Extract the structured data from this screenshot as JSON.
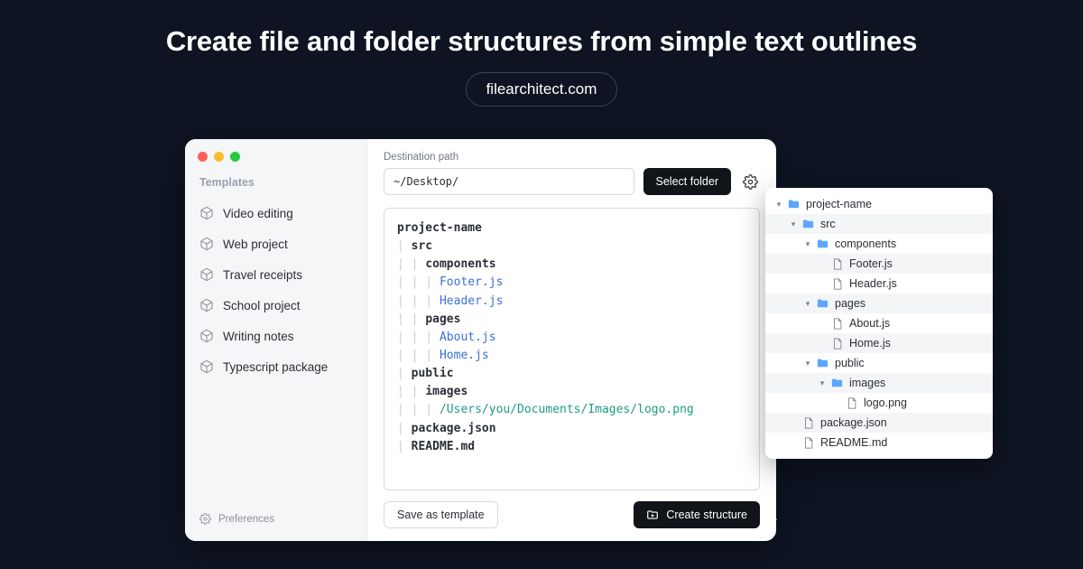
{
  "hero": {
    "title": "Create file and folder structures from simple text outlines",
    "url_badge": "filearchitect.com"
  },
  "sidebar": {
    "heading": "Templates",
    "items": [
      {
        "label": "Video editing"
      },
      {
        "label": "Web project"
      },
      {
        "label": "Travel receipts"
      },
      {
        "label": "School project"
      },
      {
        "label": "Writing notes"
      },
      {
        "label": "Typescript package"
      }
    ],
    "prefs": "Preferences"
  },
  "main": {
    "dest_label": "Destination path",
    "dest_value": "~/Desktop/",
    "select_folder": "Select folder",
    "save_template": "Save as template",
    "create_structure": "Create structure"
  },
  "outline": {
    "l0": "project-name",
    "l1": "src",
    "l2": "components",
    "l3": "Footer.js",
    "l4": "Header.js",
    "l5": "pages",
    "l6": "About.js",
    "l7": "Home.js",
    "l8": "public",
    "l9": "images",
    "l10": "/Users/you/Documents/Images/logo.png",
    "l11": "package.json",
    "l12": "README.md"
  },
  "finder": {
    "items": [
      {
        "name": "project-name",
        "type": "folder",
        "depth": 0,
        "open": true
      },
      {
        "name": "src",
        "type": "folder",
        "depth": 1,
        "open": true
      },
      {
        "name": "components",
        "type": "folder",
        "depth": 2,
        "open": true
      },
      {
        "name": "Footer.js",
        "type": "file",
        "depth": 3
      },
      {
        "name": "Header.js",
        "type": "file",
        "depth": 3
      },
      {
        "name": "pages",
        "type": "folder",
        "depth": 2,
        "open": true
      },
      {
        "name": "About.js",
        "type": "file",
        "depth": 3
      },
      {
        "name": "Home.js",
        "type": "file",
        "depth": 3
      },
      {
        "name": "public",
        "type": "folder",
        "depth": 2,
        "open": true
      },
      {
        "name": "images",
        "type": "folder",
        "depth": 3,
        "open": true
      },
      {
        "name": "logo.png",
        "type": "file",
        "depth": 4
      },
      {
        "name": "package.json",
        "type": "file",
        "depth": 1
      },
      {
        "name": "README.md",
        "type": "file",
        "depth": 1
      }
    ]
  }
}
